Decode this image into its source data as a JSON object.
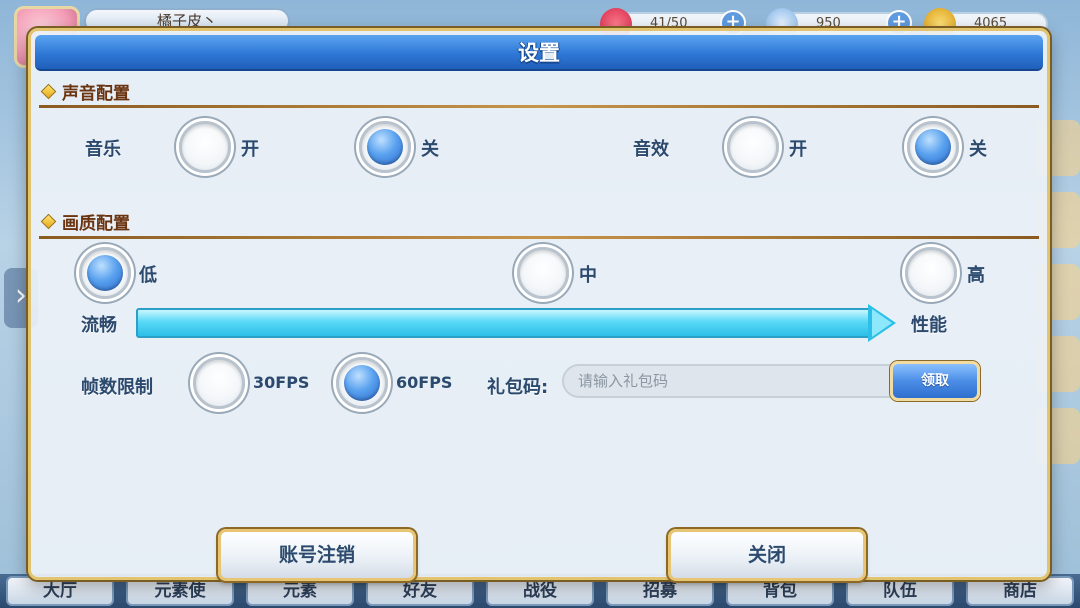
{
  "background": {
    "player_name": "橘子皮丶",
    "resources": [
      {
        "icon": "heart-icon",
        "value": "41/50",
        "color": "#e0405a"
      },
      {
        "icon": "gem-icon",
        "value": "950",
        "color": "#9fc7f0"
      },
      {
        "icon": "coin-icon",
        "value": "4065",
        "color": "#f0b830"
      }
    ],
    "bottom_nav": [
      "大厅",
      "元素使",
      "元素",
      "好友",
      "战役",
      "招募",
      "背包",
      "队伍",
      "商店"
    ]
  },
  "dialog": {
    "title": "设置",
    "sound_section": {
      "title": "声音配置",
      "music_label": "音乐",
      "effects_label": "音效",
      "on_label": "开",
      "off_label": "关",
      "music_selected": "off",
      "effects_selected": "off"
    },
    "quality_section": {
      "title": "画质配置",
      "options": [
        "低",
        "中",
        "高"
      ],
      "selected": "低",
      "left_label": "流畅",
      "right_label": "性能"
    },
    "fps": {
      "label": "帧数限制",
      "options": [
        "30FPS",
        "60FPS"
      ],
      "selected": "60FPS"
    },
    "gift_code": {
      "label": "礼包码:",
      "placeholder": "请输入礼包码",
      "value": "",
      "claim_label": "领取"
    },
    "buttons": {
      "logout": "账号注销",
      "close": "关闭"
    }
  },
  "colors": {
    "accent_blue": "#2f78d6",
    "gold_border": "#e3c46e",
    "section_brown": "#6b3410",
    "arrow_cyan": "#2cbfe8"
  }
}
